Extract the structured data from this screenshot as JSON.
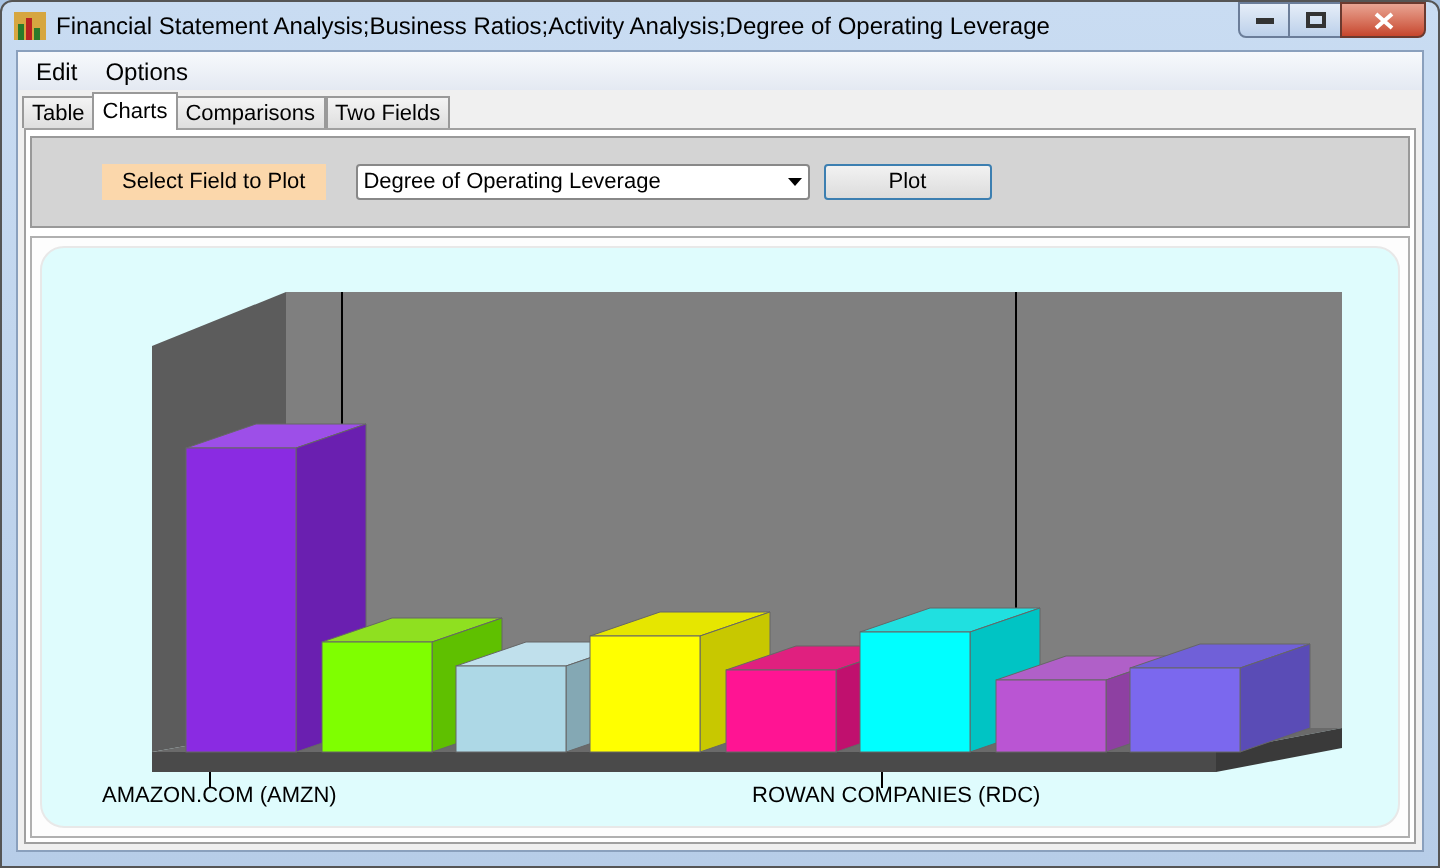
{
  "window": {
    "title": "Financial Statement Analysis;Business Ratios;Activity Analysis;Degree of Operating Leverage"
  },
  "menu": [
    "Edit",
    "Options"
  ],
  "tabs": [
    {
      "label": "Table",
      "selected": false
    },
    {
      "label": "Charts",
      "selected": true
    },
    {
      "label": "Comparisons",
      "selected": false
    },
    {
      "label": "Two Fields",
      "selected": false
    }
  ],
  "toolbar": {
    "label": "Select Field to Plot",
    "field": {
      "value": "Degree of Operating Leverage"
    },
    "button": "Plot"
  },
  "chart": {
    "category_labels": [
      "AMAZON.COM (AMZN)",
      "ROWAN COMPANIES (RDC)"
    ]
  }
}
